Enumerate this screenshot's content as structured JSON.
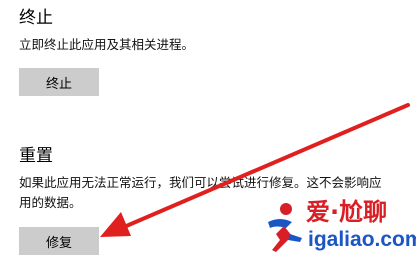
{
  "terminate": {
    "title": "终止",
    "description": "立即终止此应用及其相关进程。",
    "button_label": "终止"
  },
  "reset": {
    "title": "重置",
    "description_line1": "如果此应用无法正常运行，我们可以尝试进行修复。这不会影响应",
    "description_line2": "用的数据。",
    "button_label": "修复"
  },
  "watermark": {
    "brand": "爱·尬聊",
    "site": "igaliao.com"
  },
  "colors": {
    "button_bg": "#cccccc",
    "arrow": "#e0201f",
    "brand_red": "#d91f26",
    "brand_blue": "#1a56c4"
  }
}
